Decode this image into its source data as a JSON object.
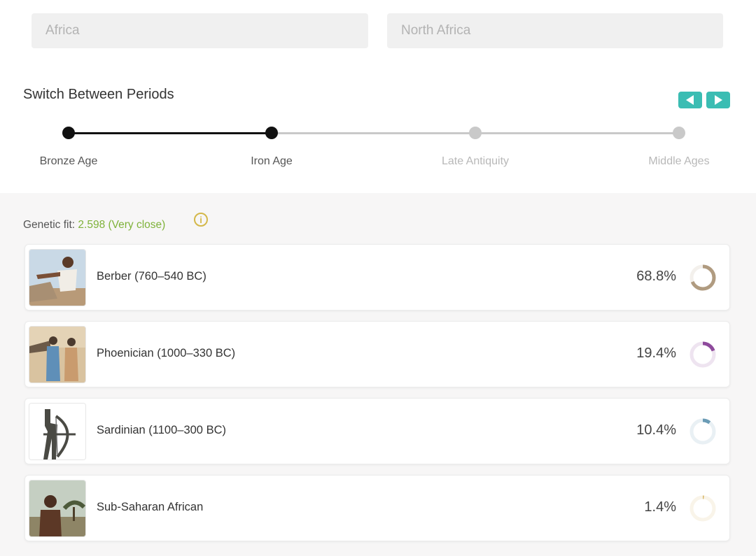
{
  "filters": {
    "region": "Africa",
    "subregion": "North Africa"
  },
  "periods": {
    "title": "Switch Between Periods",
    "items": [
      {
        "label": "Bronze Age",
        "state": "completed"
      },
      {
        "label": "Iron Age",
        "state": "active"
      },
      {
        "label": "Late Antiquity",
        "state": "inactive"
      },
      {
        "label": "Middle Ages",
        "state": "inactive"
      }
    ],
    "prev_icon": "triangle-left-icon",
    "next_icon": "triangle-right-icon"
  },
  "genetic_fit": {
    "label": "Genetic fit:",
    "value": "2.598 (Very close)",
    "info_icon": "info-icon"
  },
  "populations": [
    {
      "name": "Berber (760–540 BC)",
      "percent": "68.8%",
      "fraction": 0.688,
      "color": "#b09b80"
    },
    {
      "name": "Phoenician (1000–330 BC)",
      "percent": "19.4%",
      "fraction": 0.194,
      "color": "#8e4a9c"
    },
    {
      "name": "Sardinian (1100–300 BC)",
      "percent": "10.4%",
      "fraction": 0.104,
      "color": "#6a9bb5"
    },
    {
      "name": "Sub-Saharan African",
      "percent": "1.4%",
      "fraction": 0.014,
      "color": "#d8b86a"
    }
  ],
  "colors": {
    "accent": "#3bbdb3",
    "fit_value": "#7fb23a",
    "info": "#d4b84a"
  }
}
